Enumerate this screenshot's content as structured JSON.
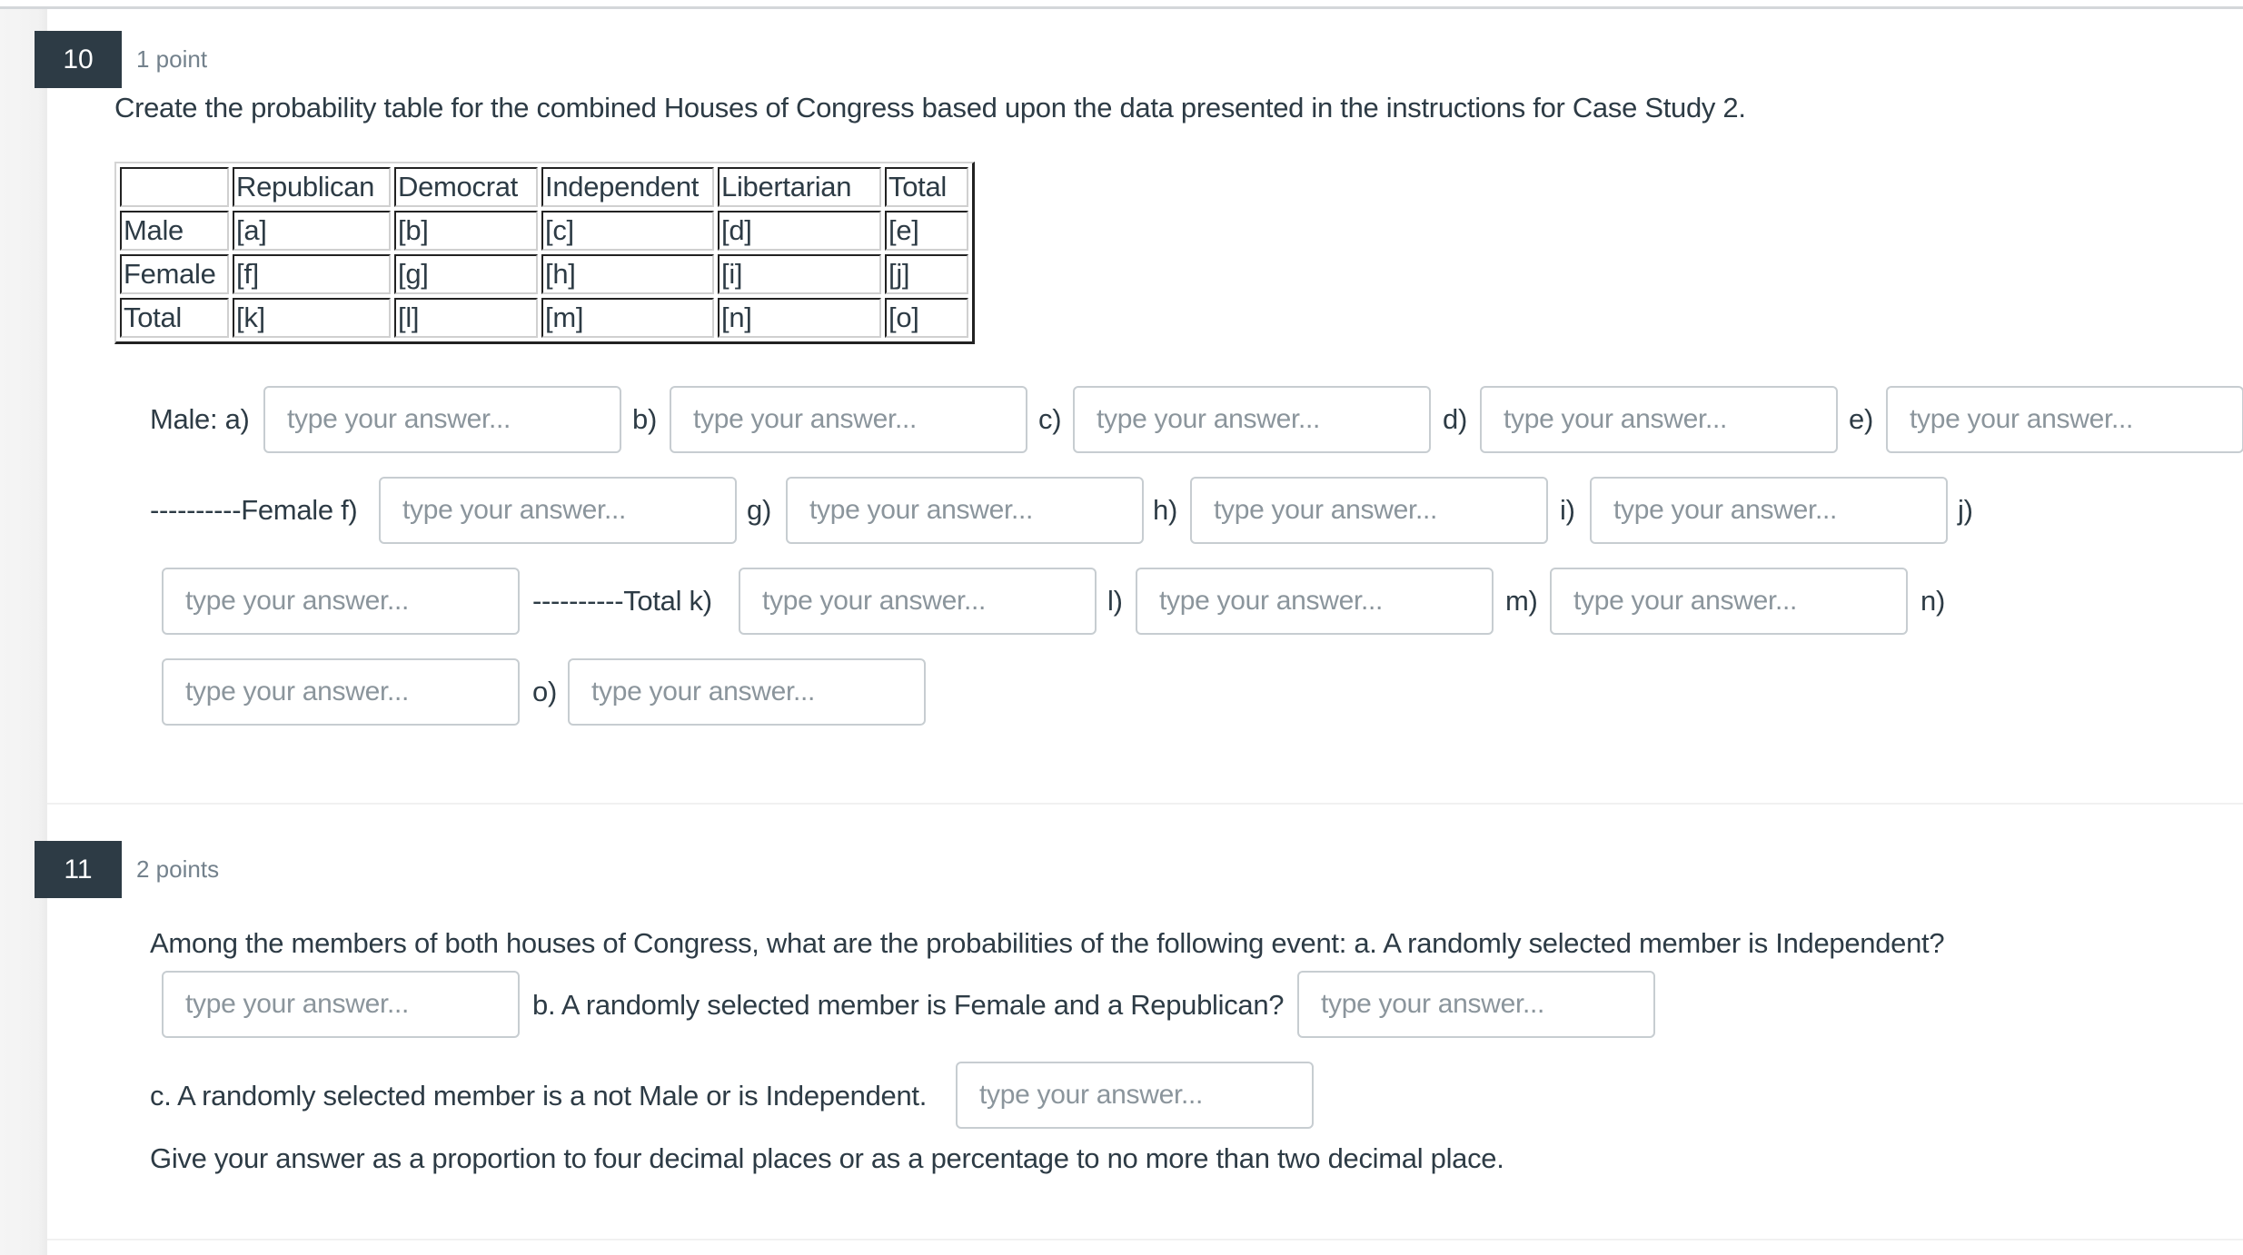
{
  "questions": [
    {
      "number": "10",
      "points": "1 point",
      "text": "Create the probability table for the combined Houses of Congress based upon the data presented in the instructions for Case Study 2.",
      "table": {
        "headers": [
          "",
          "Republican",
          "Democrat",
          "Independent",
          "Libertarian",
          "Total"
        ],
        "rows": [
          [
            "Male",
            "[a]",
            "[b]",
            "[c]",
            "[d]",
            "[e]"
          ],
          [
            "Female",
            "[f]",
            "[g]",
            "[h]",
            "[i]",
            "[j]"
          ],
          [
            "Total",
            "[k]",
            "[l]",
            "[m]",
            "[n]",
            "[o]"
          ]
        ]
      },
      "labels": {
        "male_a": "Male: a)",
        "b": "b)",
        "c": "c)",
        "d": "d)",
        "e": "e)",
        "female_f": "----------Female f)",
        "g": "g)",
        "h": "h)",
        "i": "i)",
        "j": "j)",
        "total_k": "----------Total k)",
        "l": "l)",
        "m": "m)",
        "n": "n)",
        "o": "o)"
      },
      "inputs": {
        "a": "",
        "b": "",
        "c": "",
        "d": "",
        "e": "",
        "f": "",
        "g": "",
        "h": "",
        "i": "",
        "j": "",
        "k": "",
        "l": "",
        "m": "",
        "n": "",
        "o": ""
      }
    },
    {
      "number": "11",
      "points": "2 points",
      "text_a": "Among the members of both houses of Congress, what are the probabilities of the following event: a. A randomly selected member is Independent?",
      "text_b": "b. A randomly selected member is Female and a Republican?",
      "text_c": "c. A randomly selected member is a not Male or is Independent.",
      "note": "Give your answer as a proportion to four decimal places or as a percentage to no more than two decimal place.",
      "inputs": {
        "a": "",
        "b": "",
        "c": ""
      }
    }
  ],
  "placeholder": "type your answer..."
}
